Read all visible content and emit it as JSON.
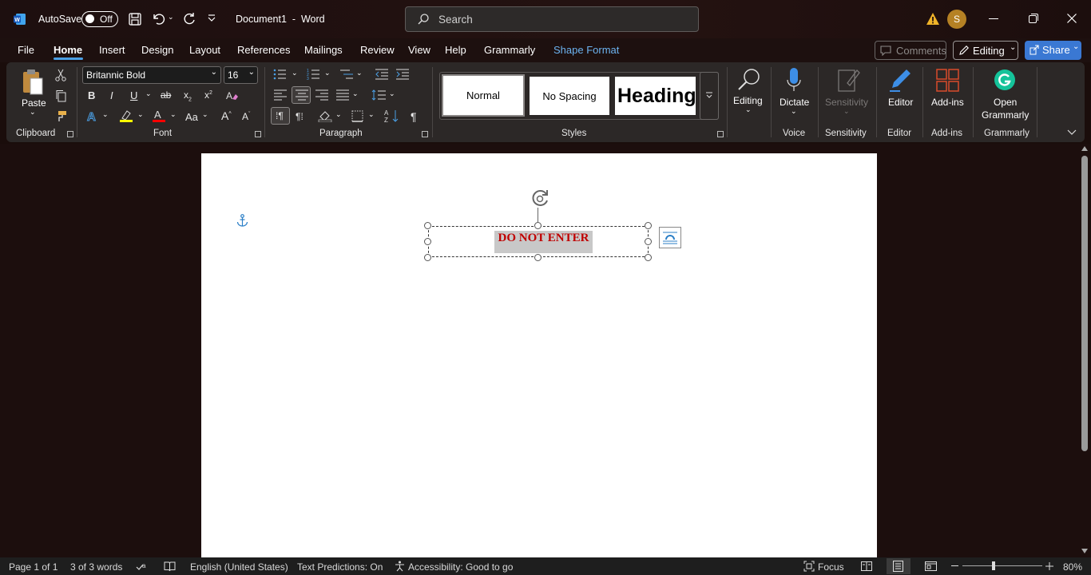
{
  "colors": {
    "accent": "#4aa0e6",
    "share_bg": "#3a78d3",
    "word_blue": "#185abd",
    "warning": "#f0b429",
    "avatar_bg": "#b58124",
    "text_red": "#c00000",
    "grammarly": "#15c39a"
  },
  "titlebar": {
    "autosave_label": "AutoSave",
    "toggle_state": "Off",
    "doc_title": "Document1  -  Word",
    "search_placeholder": "Search",
    "avatar_initial": "S"
  },
  "menu": {
    "tabs": [
      "File",
      "Home",
      "Insert",
      "Design",
      "Layout",
      "References",
      "Mailings",
      "Review",
      "View",
      "Help",
      "Grammarly",
      "Shape Format"
    ],
    "active_tab": "Home",
    "comments_label": "Comments",
    "editing_label": "Editing",
    "share_label": "Share"
  },
  "ribbon": {
    "clipboard": {
      "paste_label": "Paste",
      "group_label": "Clipboard"
    },
    "font": {
      "font_name": "Britannic Bold",
      "font_size": "16",
      "group_label": "Font",
      "bold": "B",
      "italic": "I",
      "underline": "U",
      "strike": "ab",
      "subscript": "x",
      "superscript": "x",
      "grow": "A",
      "shrink": "A",
      "case": "Aa"
    },
    "paragraph": {
      "group_label": "Paragraph"
    },
    "styles": {
      "items": [
        "Normal",
        "No Spacing",
        "Heading"
      ],
      "group_label": "Styles"
    },
    "editing": {
      "label": "Editing"
    },
    "voice": {
      "label": "Dictate",
      "group_label": "Voice"
    },
    "sensitivity": {
      "label": "Sensitivity",
      "group_label": "Sensitivity"
    },
    "editor": {
      "label": "Editor",
      "group_label": "Editor"
    },
    "addins": {
      "label": "Add-ins",
      "group_label": "Add-ins"
    },
    "grammarly": {
      "label_line1": "Open",
      "label_line2": "Grammarly",
      "group_label": "Grammarly"
    }
  },
  "document": {
    "textbox_text": "DO NOT ENTER"
  },
  "status": {
    "page": "Page 1 of 1",
    "words": "3 of 3 words",
    "language": "English (United States)",
    "predictions": "Text Predictions: On",
    "accessibility": "Accessibility: Good to go",
    "focus": "Focus",
    "zoom": "80%"
  },
  "icons": [
    "word-logo-icon",
    "save-icon",
    "undo-icon",
    "redo-icon",
    "customize-qat-icon",
    "search-icon",
    "warning-icon",
    "minimize-icon",
    "restore-icon",
    "close-icon",
    "paste-icon",
    "cut-icon",
    "copy-icon",
    "format-painter-icon",
    "anchor-icon",
    "rotate-handle-icon",
    "layout-options-icon",
    "microphone-icon",
    "editor-pen-icon",
    "add-ins-icon",
    "grammarly-icon",
    "focus-icon",
    "zoom-slider"
  ]
}
